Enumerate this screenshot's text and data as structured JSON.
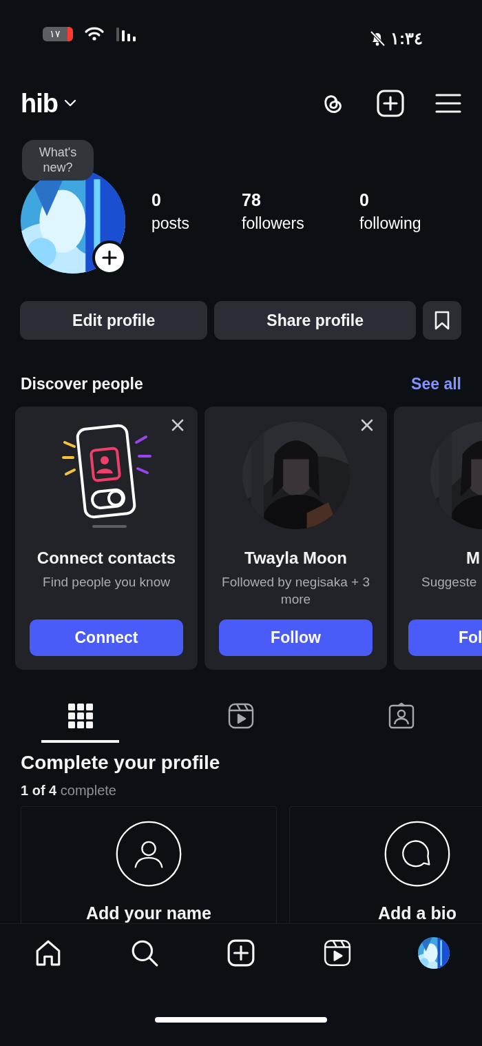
{
  "status_bar": {
    "battery": "١٧",
    "time": "١:٣٤"
  },
  "header": {
    "username": "hib"
  },
  "profile": {
    "tooltip": "What's new?",
    "stats": [
      {
        "value": "0",
        "label": "posts"
      },
      {
        "value": "78",
        "label": "followers"
      },
      {
        "value": "0",
        "label": "following"
      }
    ]
  },
  "actions": [
    "Edit profile",
    "Share profile"
  ],
  "discover": {
    "title": "Discover people",
    "link": "See all",
    "cards": [
      {
        "kind": "contacts",
        "name": "Connect contacts",
        "subtitle": "Find people you know",
        "button": "Connect",
        "dismissible": true
      },
      {
        "kind": "person",
        "name": "Twayla Moon",
        "subtitle": "Followed by negisaka + 3 more",
        "button": "Follow",
        "dismissible": true
      },
      {
        "kind": "partial",
        "name": "M",
        "subtitle": "Suggeste",
        "button": "Fol",
        "dismissible": false
      }
    ]
  },
  "tabs": [
    {
      "kind": "grid",
      "selected": true
    },
    {
      "kind": "reels",
      "selected": false
    },
    {
      "kind": "tagged",
      "selected": false
    }
  ],
  "complete": {
    "title": "Complete your profile",
    "progress": "**1 of 4** complete",
    "cards": [
      {
        "kind": "name",
        "label": "Add your name"
      },
      {
        "kind": "bio",
        "label": "Add a bio"
      }
    ]
  },
  "bottom_nav": [
    {
      "kind": "home"
    },
    {
      "kind": "search"
    },
    {
      "kind": "create"
    },
    {
      "kind": "reels"
    },
    {
      "kind": "profile"
    }
  ]
}
